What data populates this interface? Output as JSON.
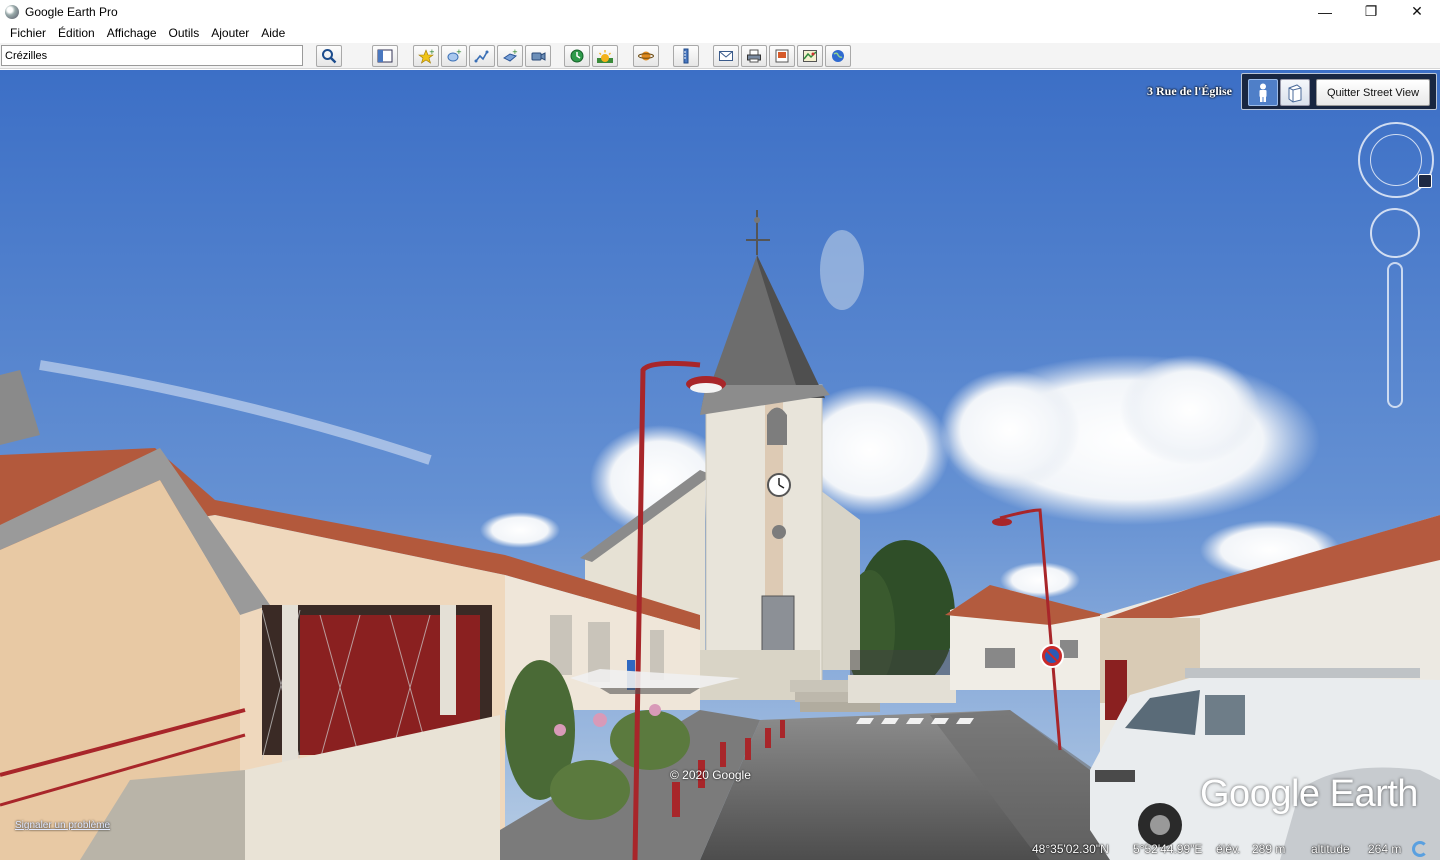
{
  "window": {
    "title": "Google Earth Pro",
    "controls": {
      "minimize": "—",
      "restore": "❐",
      "close": "✕"
    }
  },
  "menu": [
    {
      "label": "Fichier"
    },
    {
      "label": "Édition"
    },
    {
      "label": "Affichage"
    },
    {
      "label": "Outils"
    },
    {
      "label": "Ajouter"
    },
    {
      "label": "Aide"
    }
  ],
  "search": {
    "value": "Crézilles"
  },
  "toolbar_icons": [
    "search-icon",
    "sidebar-toggle-icon",
    "add-placemark-icon",
    "add-polygon-icon",
    "add-path-icon",
    "image-overlay-icon",
    "record-tour-icon",
    "historical-imagery-icon",
    "sunlight-icon",
    "planets-icon",
    "ruler-icon",
    "email-icon",
    "print-icon",
    "save-image-icon",
    "view-in-maps-icon",
    "earth-gallery-icon"
  ],
  "streetview": {
    "address": "3 Rue de l'Église",
    "quit_label": "Quitter Street View",
    "copyright": "© 2020 Google",
    "report_link": "Signaler un problème",
    "logo": "Google Earth"
  },
  "status": {
    "lat": "48°35'02.30\"N",
    "lon": "5°52'44.99\"E",
    "elev_label": "élév.",
    "elev_value": "289 m",
    "alt_label": "altitude",
    "alt_value": "264 m"
  },
  "colors": {
    "sky_top": "#3f72c9",
    "sky_bottom": "#a9c3e0",
    "roof_tile": "#b85a3c",
    "pole_red": "#a8262a"
  }
}
